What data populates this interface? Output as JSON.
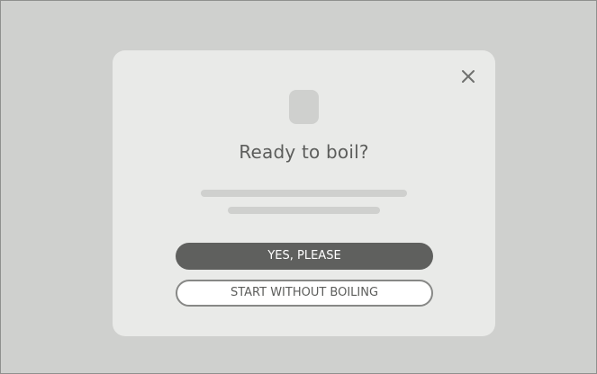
{
  "dialog": {
    "title": "Ready to boil?",
    "primary_button_label": "YES, PLEASE",
    "secondary_button_label": "START WITHOUT BOILING",
    "close_icon": "close-icon",
    "app_icon": "app-icon-placeholder"
  },
  "colors": {
    "backdrop": "#cfd0ce",
    "modal_background": "#e9eae8",
    "primary_button": "#5f605e",
    "text": "#5c5d5b",
    "placeholder": "#cfd0ce"
  }
}
